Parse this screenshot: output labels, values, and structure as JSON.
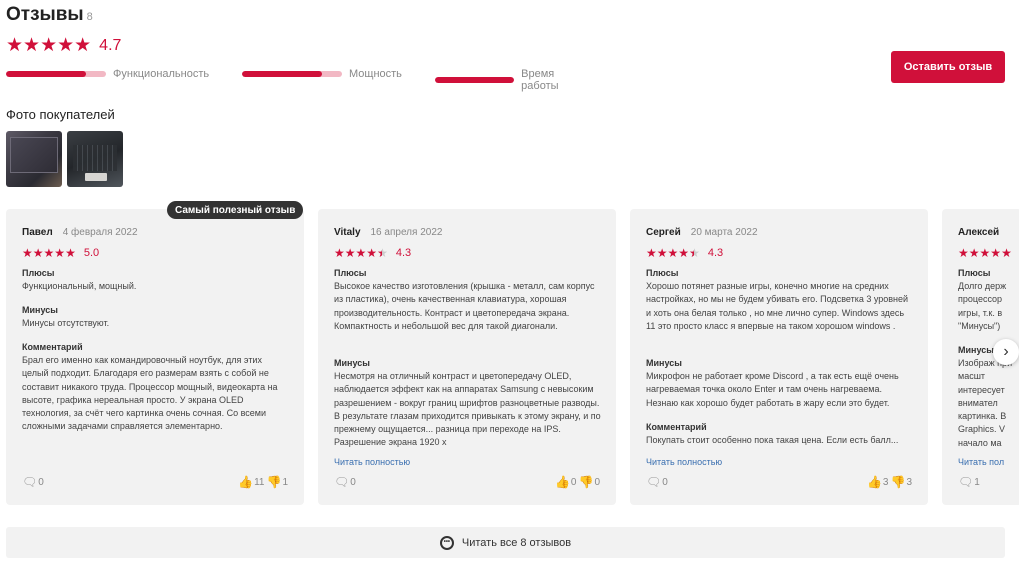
{
  "header": {
    "title": "Отзывы",
    "count": "8"
  },
  "overall": {
    "rating": "4.7",
    "stars": "★★★★★"
  },
  "criteria": [
    {
      "label": "Функциональность",
      "fill": 0.8
    },
    {
      "label": "Мощность",
      "fill": 0.8
    },
    {
      "label": "Время работы",
      "fill": 1.0
    }
  ],
  "leave_review_label": "Оставить отзыв",
  "photos": {
    "title": "Фото покупателей"
  },
  "badge": "Самый полезный отзыв",
  "reviews": [
    {
      "author": "Павел",
      "date": "4 февраля 2022",
      "rating": "5.0",
      "stars_value": 5,
      "pros_title": "Плюсы",
      "pros": "Функциональный, мощный.",
      "cons_title": "Минусы",
      "cons": "Минусы отсутствуют.",
      "comment_title": "Комментарий",
      "comment": "Брал его именно как командировочный ноутбук, для этих целый подходит. Благодаря его размерам взять с собой не составит никакого труда. Процессор мощный, видеокарта на высоте, графика нереальная просто. У экрана OLED технология, за счёт чего картинка очень сочная. Со всеми сложными задачами справляется элементарно.",
      "comments_count": "0",
      "likes": "11",
      "dislikes": "1"
    },
    {
      "author": "Vitaly",
      "date": "16 апреля 2022",
      "rating": "4.3",
      "stars_value": 4.5,
      "pros_title": "Плюсы",
      "pros": "Высокое качество изготовления (крышка - металл, сам корпус из пластика), очень качественная клавиатура, хорошая производительность. Контраст и цветопередача экрана. Компактность и небольшой вес для такой диагонали.",
      "cons_title": "Минусы",
      "cons": "Несмотря на отличный контраст и цветопередачу OLED, наблюдается эффект как на аппаратах Samsung с невысоким разрешением - вокруг границ шрифтов разноцветные разводы. В результате глазам приходится привыкать к этому экрану, и по прежнему ощущается... разница при переходе на IPS. Разрешение экрана 1920 x",
      "read_more": "Читать полностью",
      "comments_count": "0",
      "likes": "0",
      "dislikes": "0"
    },
    {
      "author": "Сергей",
      "date": "20 марта 2022",
      "rating": "4.3",
      "stars_value": 4.5,
      "pros_title": "Плюсы",
      "pros": "Хорошо потянет разные игры, конечно многие на средних настройках, но мы не будем убивать его. Подсветка 3 уровней и хоть она белая только , но мне лично супер. Windows здесь 11 это просто класс я впервые на таком хорошом windows .",
      "cons_title": "Минусы",
      "cons": "Микрофон не работает кроме Discord , а так есть ещё очень нагреваемая точка около Enter и там очень нагреваема. Незнаю как хорошо будет работать в жару если это будет.",
      "comment_title": "Комментарий",
      "comment": "Покупать стоит особенно пока такая цена. Если есть балл...",
      "read_more": "Читать полностью",
      "comments_count": "0",
      "likes": "3",
      "dislikes": "3"
    },
    {
      "author": "Алексей",
      "date": "",
      "rating": "",
      "stars_value": 5,
      "pros_title": "Плюсы",
      "pros": "Долго держ процессор игры, т.к. в \"Минусы\")",
      "cons_title": "Минусы",
      "cons": "Изображ при масшт интересует внимател картинка. В Graphics. V начало ма",
      "read_more": "Читать пол",
      "comments_count": "1"
    }
  ],
  "read_all_label": "Читать все 8 отзывов",
  "colors": {
    "accent": "#d0103a",
    "card_bg": "#f2f2f2",
    "link": "#3a6fb0"
  },
  "icons": [
    "star-icon",
    "comment-icon",
    "thumb-up-icon",
    "thumb-down-icon",
    "chevron-right-icon",
    "chat-icon"
  ]
}
